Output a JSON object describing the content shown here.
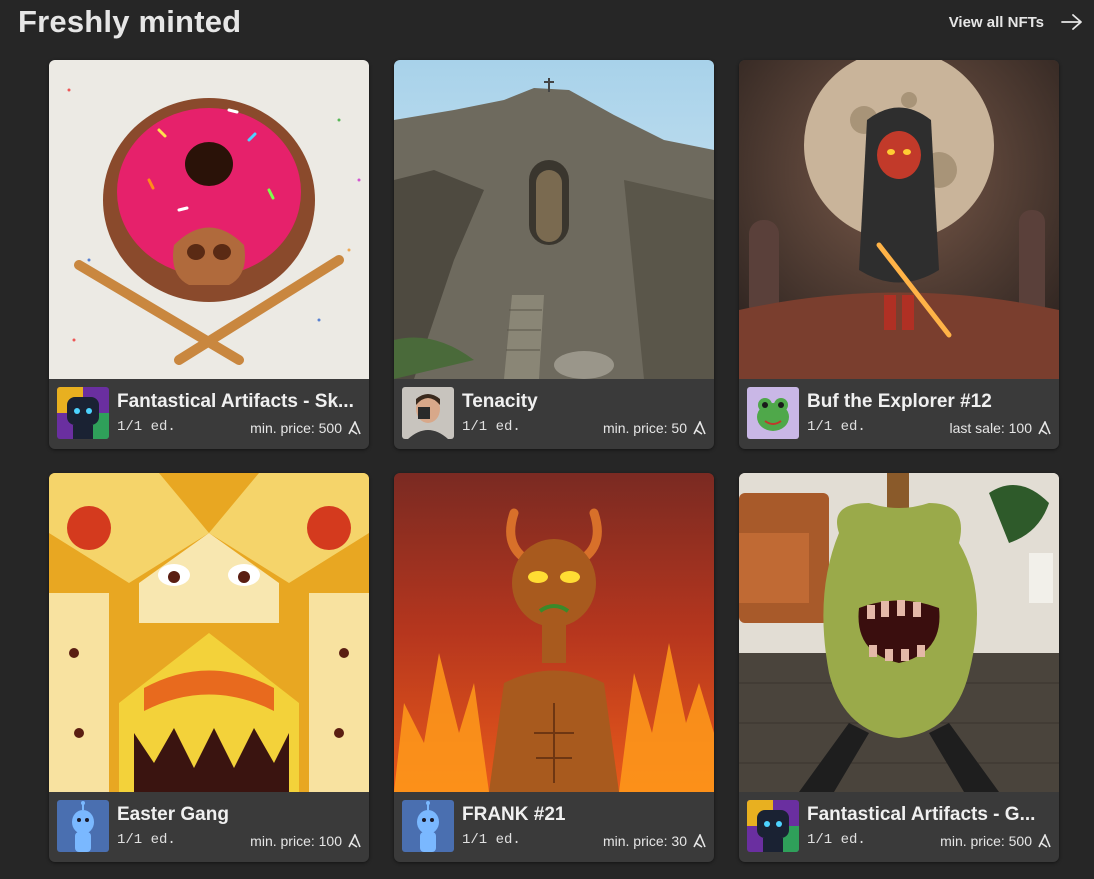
{
  "header": {
    "title": "Freshly minted",
    "view_all_label": "View all NFTs",
    "arrow_icon": "arrow-right-icon"
  },
  "currency_icon": "algorand-icon",
  "cards": [
    {
      "name": "Fantastical Artifacts - Sk...",
      "edition": "1/1 ed.",
      "price_text": "min. price: 500",
      "avatar": "robot-avatar",
      "image": "pink-skull-donut"
    },
    {
      "name": "Tenacity",
      "edition": "1/1 ed.",
      "price_text": "min. price: 50",
      "avatar": "man-with-camera-avatar",
      "image": "rock-chapel-landscape"
    },
    {
      "name": "Buf the Explorer #12",
      "edition": "1/1 ed.",
      "price_text": "last sale: 100",
      "avatar": "green-frog-avatar",
      "image": "hooded-explorer-moon"
    },
    {
      "name": "Easter Gang",
      "edition": "1/1 ed.",
      "price_text": "min. price: 100",
      "avatar": "blue-alien-avatar",
      "image": "easter-doodle-pattern"
    },
    {
      "name": "FRANK #21",
      "edition": "1/1 ed.",
      "price_text": "min. price: 30",
      "avatar": "blue-alien-avatar",
      "image": "devil-fire"
    },
    {
      "name": "Fantastical Artifacts - G...",
      "edition": "1/1 ed.",
      "price_text": "min. price: 500",
      "avatar": "robot-avatar",
      "image": "monster-guitar"
    }
  ]
}
